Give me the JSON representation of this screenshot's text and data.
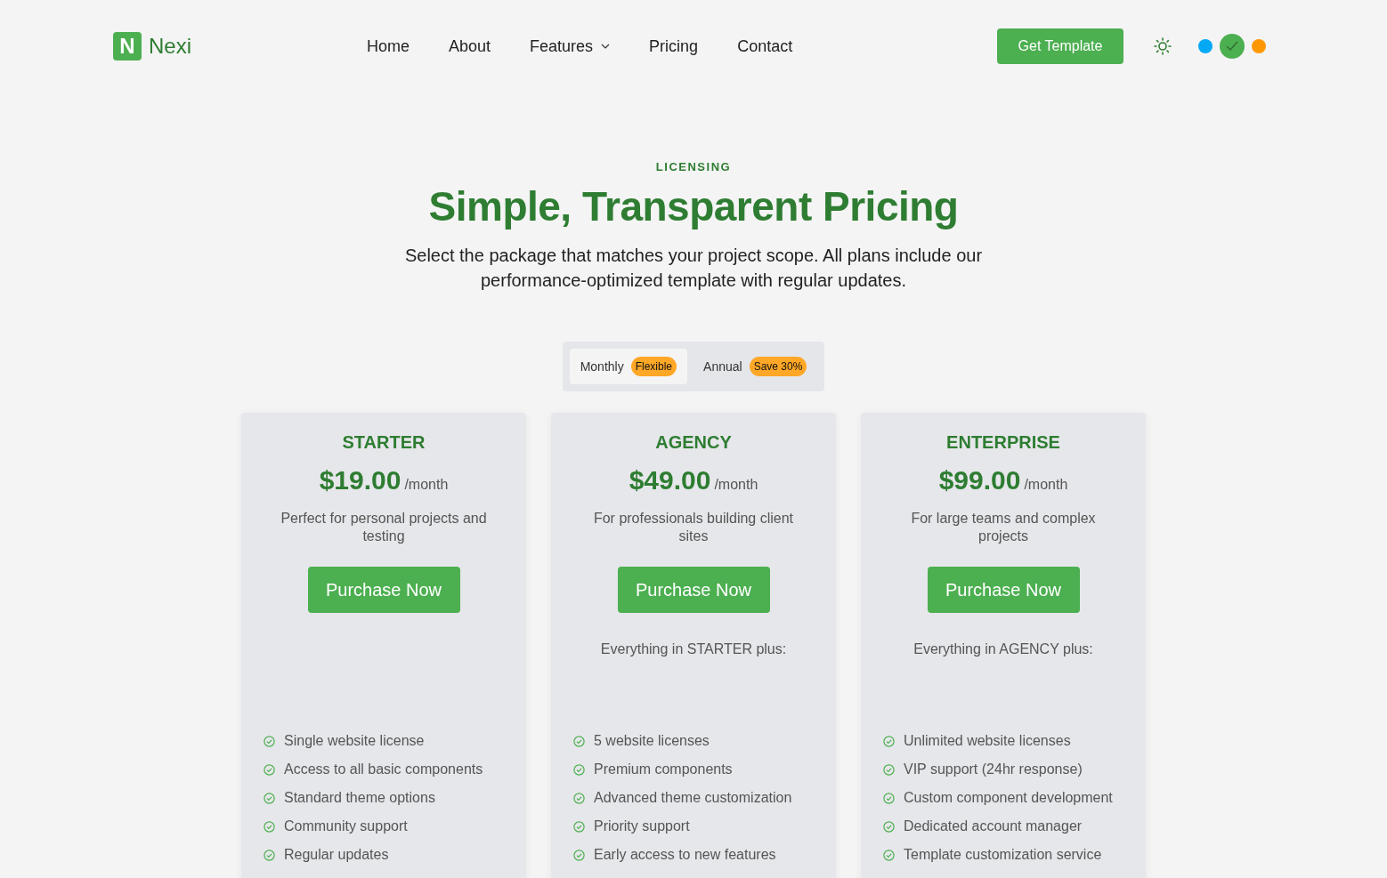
{
  "brand": {
    "logo_letter": "N",
    "name": "Nexi"
  },
  "nav": [
    {
      "label": "Home",
      "has_menu": false
    },
    {
      "label": "About",
      "has_menu": false
    },
    {
      "label": "Features",
      "has_menu": true
    },
    {
      "label": "Pricing",
      "has_menu": false
    },
    {
      "label": "Contact",
      "has_menu": false
    }
  ],
  "cta": "Get Template",
  "theme_colors": [
    {
      "color": "#03a9f4",
      "selected": false
    },
    {
      "color": "#4caf50",
      "selected": true
    },
    {
      "color": "#ff9800",
      "selected": false
    }
  ],
  "hero": {
    "eyebrow": "LICENSING",
    "title": "Simple, Transparent Pricing",
    "subtitle": "Select the package that matches your project scope. All plans include our performance-optimized template with regular updates."
  },
  "billing": [
    {
      "label": "Monthly",
      "badge": "Flexible",
      "selected": true
    },
    {
      "label": "Annual",
      "badge": "Save 30%",
      "selected": false
    }
  ],
  "plans": [
    {
      "name": "STARTER",
      "price": "$19.00",
      "period": "/month",
      "description": "Perfect for personal projects and testing",
      "button": "Purchase Now",
      "features": [
        "Single website license",
        "Access to all basic components",
        "Standard theme options",
        "Community support",
        "Regular updates"
      ]
    },
    {
      "name": "AGENCY",
      "price": "$49.00",
      "period": "/month",
      "description": "For professionals building client sites",
      "button": "Purchase Now",
      "includes": "Everything in STARTER plus:",
      "features": [
        "5 website licenses",
        "Premium components",
        "Advanced theme customization",
        "Priority support",
        "Early access to new features"
      ]
    },
    {
      "name": "ENTERPRISE",
      "price": "$99.00",
      "period": "/month",
      "description": "For large teams and complex projects",
      "button": "Purchase Now",
      "includes": "Everything in AGENCY plus:",
      "features": [
        "Unlimited website licenses",
        "VIP support (24hr response)",
        "Custom component development",
        "Dedicated account manager",
        "Template customization service"
      ]
    }
  ]
}
